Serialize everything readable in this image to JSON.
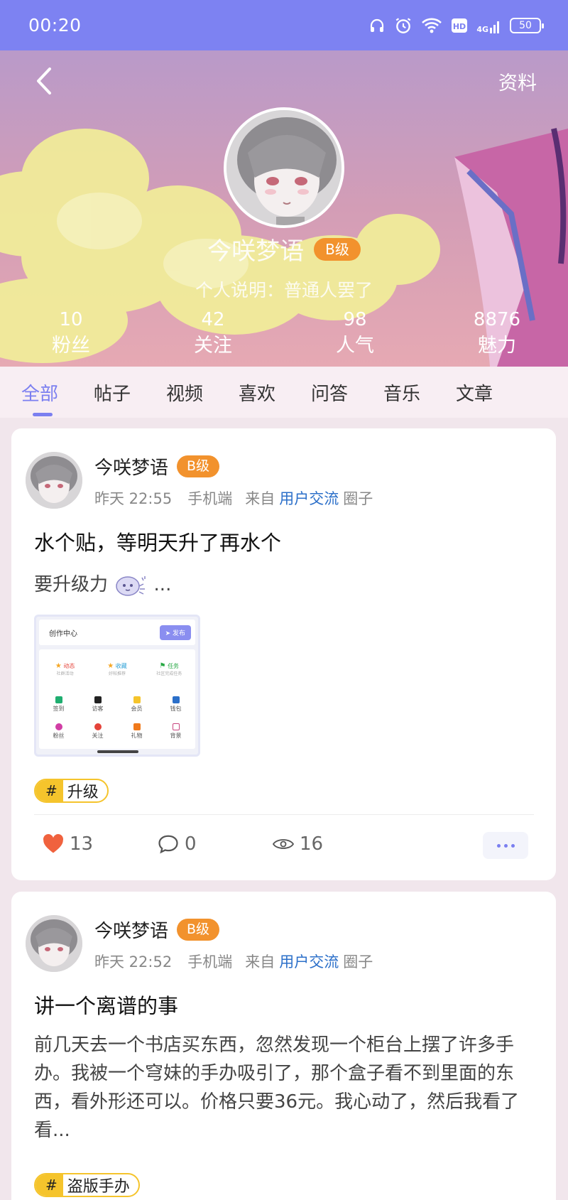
{
  "status_bar": {
    "time": "00:20",
    "network": "4G",
    "battery": "50",
    "icons": [
      "headphones-icon",
      "alarm-icon",
      "wifi-icon",
      "hd-icon",
      "signal-icon",
      "battery-icon"
    ]
  },
  "header": {
    "back_icon": "chevron-left-icon",
    "profile_link": "资料",
    "name": "今咲梦语",
    "level": "B级",
    "bio": "个人说明：普通人罢了",
    "stats": [
      {
        "value": "10",
        "label": "粉丝"
      },
      {
        "value": "42",
        "label": "关注"
      },
      {
        "value": "98",
        "label": "人气"
      },
      {
        "value": "8876",
        "label": "魅力"
      }
    ]
  },
  "tabs": [
    {
      "label": "全部",
      "active": true
    },
    {
      "label": "帖子",
      "active": false
    },
    {
      "label": "视频",
      "active": false
    },
    {
      "label": "喜欢",
      "active": false
    },
    {
      "label": "问答",
      "active": false
    },
    {
      "label": "音乐",
      "active": false
    },
    {
      "label": "文章",
      "active": false
    }
  ],
  "posts": [
    {
      "author": "今咲梦语",
      "level": "B级",
      "time": "昨天 22:55",
      "device": "手机端",
      "from_prefix": "来自",
      "circle": "用户交流",
      "circle_suffix": "圈子",
      "title": "水个贴，等明天升了再水个",
      "excerpt_before": "要升级力",
      "excerpt_after": "...",
      "thumbnail": {
        "title": "创作中心",
        "publish": "发布",
        "row1": [
          {
            "label": "动态",
            "sub": "社群活动",
            "color": "#f5a623"
          },
          {
            "label": "收藏",
            "sub": "好帖推荐",
            "color": "#f5a623"
          },
          {
            "label": "任务",
            "sub": "社区完成任务",
            "color": "#27a844"
          }
        ],
        "row2": [
          {
            "label": "签到",
            "color": "#1fae70"
          },
          {
            "label": "访客",
            "color": "#222222"
          },
          {
            "label": "会员",
            "color": "#f5c42c"
          },
          {
            "label": "钱包",
            "color": "#2b6fc9"
          }
        ],
        "row3": [
          {
            "label": "粉丝",
            "color": "#d13ea5"
          },
          {
            "label": "关注",
            "color": "#e5433a"
          },
          {
            "label": "礼物",
            "color": "#f07a1c"
          },
          {
            "label": "背景",
            "color": "#c8467f"
          }
        ]
      },
      "tag": "升级",
      "likes": "13",
      "comments": "0",
      "views": "16"
    },
    {
      "author": "今咲梦语",
      "level": "B级",
      "time": "昨天 22:52",
      "device": "手机端",
      "from_prefix": "来自",
      "circle": "用户交流",
      "circle_suffix": "圈子",
      "title": "讲一个离谱的事",
      "excerpt": "前几天去一个书店买东西，忽然发现一个柜台上摆了许多手办。我被一个穹妹的手办吸引了，那个盒子看不到里面的东西，看外形还可以。价格只要36元。我心动了，然后我看了看...",
      "tag": "盗版手办"
    }
  ],
  "colors": {
    "accent": "#7b7ff0",
    "status_bar": "#7d82f2",
    "badge": "#f2922d",
    "link": "#2b6fc9",
    "tag": "#f5c42c",
    "like": "#f0623e"
  }
}
